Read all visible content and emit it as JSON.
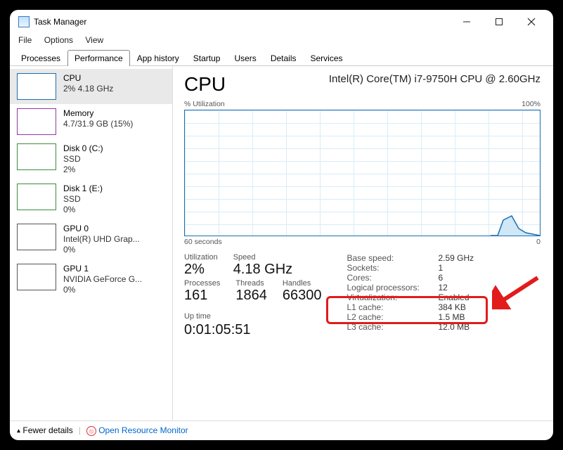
{
  "window": {
    "title": "Task Manager"
  },
  "menu": {
    "file": "File",
    "options": "Options",
    "view": "View"
  },
  "tabs": {
    "processes": "Processes",
    "performance": "Performance",
    "app_history": "App history",
    "startup": "Startup",
    "users": "Users",
    "details": "Details",
    "services": "Services"
  },
  "sidebar": {
    "cpu": {
      "title": "CPU",
      "sub": "2% 4.18 GHz"
    },
    "memory": {
      "title": "Memory",
      "sub": "4.7/31.9 GB (15%)"
    },
    "disk0": {
      "title": "Disk 0 (C:)",
      "sub1": "SSD",
      "sub2": "2%"
    },
    "disk1": {
      "title": "Disk 1 (E:)",
      "sub1": "SSD",
      "sub2": "0%"
    },
    "gpu0": {
      "title": "GPU 0",
      "sub1": "Intel(R) UHD Grap...",
      "sub2": "0%"
    },
    "gpu1": {
      "title": "GPU 1",
      "sub1": "NVIDIA GeForce G...",
      "sub2": "0%"
    }
  },
  "main": {
    "title": "CPU",
    "model": "Intel(R) Core(TM) i7-9750H CPU @ 2.60GHz",
    "chart_top_left": "% Utilization",
    "chart_top_right": "100%",
    "chart_bot_left": "60 seconds",
    "chart_bot_right": "0",
    "utilization_lbl": "Utilization",
    "utilization_val": "2%",
    "speed_lbl": "Speed",
    "speed_val": "4.18 GHz",
    "processes_lbl": "Processes",
    "processes_val": "161",
    "threads_lbl": "Threads",
    "threads_val": "1864",
    "handles_lbl": "Handles",
    "handles_val": "66300",
    "uptime_lbl": "Up time",
    "uptime_val": "0:01:05:51",
    "right": {
      "base_speed_k": "Base speed:",
      "base_speed_v": "2.59 GHz",
      "sockets_k": "Sockets:",
      "sockets_v": "1",
      "cores_k": "Cores:",
      "cores_v": "6",
      "lproc_k": "Logical processors:",
      "lproc_v": "12",
      "virt_k": "Virtualization:",
      "virt_v": "Enabled",
      "l1_k": "L1 cache:",
      "l1_v": "384 KB",
      "l2_k": "L2 cache:",
      "l2_v": "1.5 MB",
      "l3_k": "L3 cache:",
      "l3_v": "12.0 MB"
    }
  },
  "footer": {
    "fewer": "Fewer details",
    "open_rm": "Open Resource Monitor"
  }
}
